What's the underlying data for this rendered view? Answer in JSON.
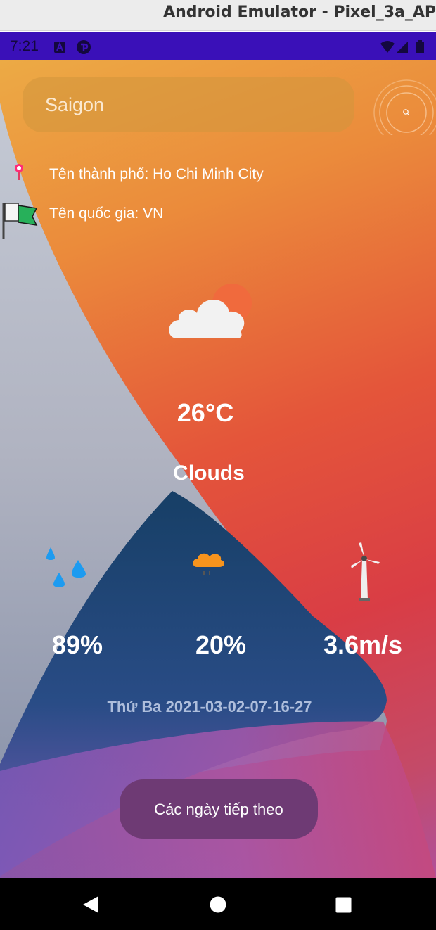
{
  "window": {
    "title": "Android Emulator - Pixel_3a_AP"
  },
  "status_bar": {
    "time": "7:21",
    "icons_left": [
      "a-notification-icon",
      "app-notification-icon"
    ],
    "icons_right": [
      "wifi-icon",
      "signal-icon",
      "battery-icon"
    ]
  },
  "search": {
    "value": "Saigon",
    "button_icon": "search-icon"
  },
  "location": {
    "city_line": "Tên thành phố: Ho Chi Minh City",
    "country_line": "Tên quốc gia: VN",
    "city_icon": "map-pin-icon",
    "country_icon": "flag-icon"
  },
  "weather": {
    "icon": "cloud-sun-icon",
    "temperature": "26°C",
    "condition": "Clouds"
  },
  "stats": [
    {
      "icon": "humidity-drops-icon",
      "value": "89%"
    },
    {
      "icon": "rain-cloud-icon",
      "value": "20%"
    },
    {
      "icon": "wind-turbine-icon",
      "value": "3.6m/s"
    }
  ],
  "datetime": "Thứ Ba 2021-03-02-07-16-27",
  "next_days_button": "Các ngày tiếp theo",
  "colors": {
    "status_bar": "#3a10b8",
    "button_bg": "#6e3a74",
    "datetime_text": "#aebedc"
  }
}
